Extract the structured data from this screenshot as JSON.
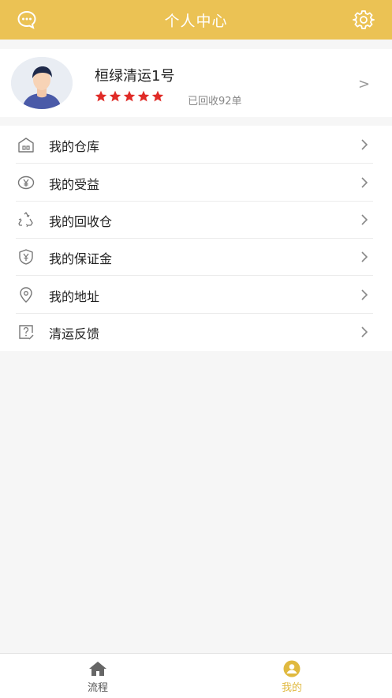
{
  "header": {
    "title": "个人中心",
    "left_icon": "chat-bubble-icon",
    "right_icon": "gear-icon",
    "bg_color": "#ebc254"
  },
  "profile": {
    "name": "桓绿清运1号",
    "rating": 5,
    "collected_text": "已回收92单",
    "chevron": ">",
    "star_color": "#e02b27"
  },
  "menu": {
    "items": [
      {
        "label": "我的仓库",
        "icon": "warehouse-icon"
      },
      {
        "label": "我的受益",
        "icon": "yen-coin-icon"
      },
      {
        "label": "我的回收仓",
        "icon": "recycle-icon"
      },
      {
        "label": "我的保证金",
        "icon": "shield-yen-icon"
      },
      {
        "label": "我的地址",
        "icon": "location-pin-icon"
      },
      {
        "label": "清运反馈",
        "icon": "feedback-question-icon"
      }
    ]
  },
  "tabbar": {
    "tabs": [
      {
        "label": "流程",
        "icon": "home-icon",
        "active": false
      },
      {
        "label": "我的",
        "icon": "user-circle-icon",
        "active": true
      }
    ],
    "active_color": "#e0b93f"
  }
}
